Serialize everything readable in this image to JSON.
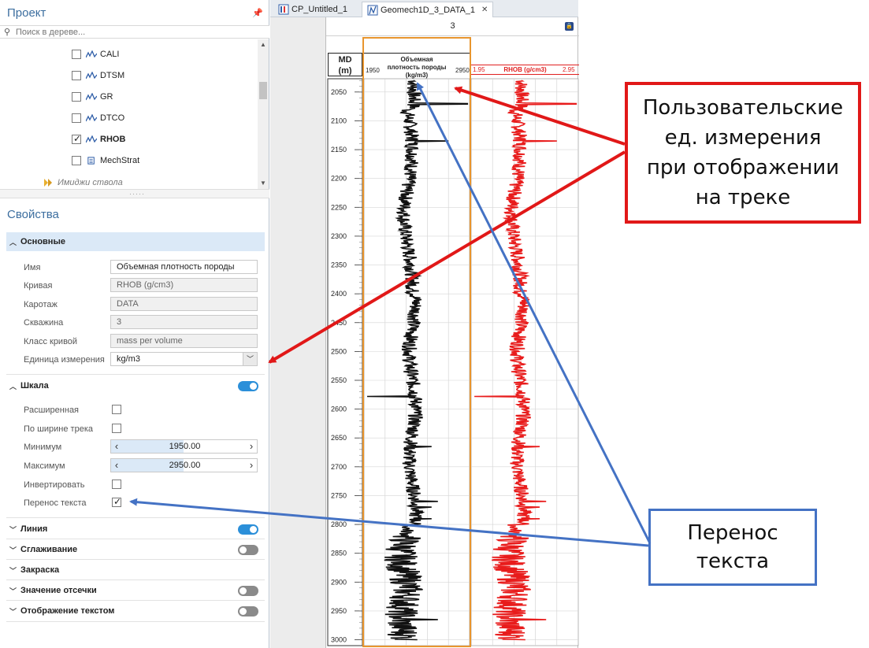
{
  "project_panel": {
    "title": "Проект",
    "search_placeholder": "Поиск в дереве...",
    "tree_items": [
      {
        "label": "CALI",
        "checked": false
      },
      {
        "label": "DTSM",
        "checked": false
      },
      {
        "label": "GR",
        "checked": false
      },
      {
        "label": "DTCO",
        "checked": false
      },
      {
        "label": "RHOB",
        "checked": true
      },
      {
        "label": "MechStrat",
        "checked": false
      }
    ],
    "folder_label": "Имиджи ствола"
  },
  "properties": {
    "title": "Свойства",
    "sections": {
      "main": "Основные",
      "scale": "Шкала",
      "line": "Линия",
      "smoothing": "Сглаживание",
      "fill": "Закраска",
      "cutoff": "Значение отсечки",
      "text_display": "Отображение текстом"
    },
    "fields": {
      "name_label": "Имя",
      "name_value": "Объемная плотность породы",
      "curve_label": "Кривая",
      "curve_value": "RHOB (g/cm3)",
      "log_label": "Каротаж",
      "log_value": "DATA",
      "well_label": "Скважина",
      "well_value": "3",
      "curve_class_label": "Класс кривой",
      "curve_class_value": "mass per volume",
      "unit_label": "Единица измерения",
      "unit_value": "kg/m3"
    },
    "scale": {
      "extended_label": "Расширенная",
      "track_width_label": "По ширине трека",
      "min_label": "Минимум",
      "min_value": "1950.00",
      "max_label": "Максимум",
      "max_value": "2950.00",
      "invert_label": "Инвертировать",
      "wrap_label": "Перенос текста"
    }
  },
  "tabs": [
    {
      "label": "CP_Untitled_1",
      "active": false
    },
    {
      "label": "Geomech1D_3_DATA_1",
      "active": true,
      "close": "✕"
    }
  ],
  "plot": {
    "track_title": "3",
    "md_label": "MD",
    "md_unit": "(m)",
    "track1_title": "Объемная плотность породы (kg/m3)",
    "track1_min": "1950",
    "track1_max": "2950",
    "track2_title": "RHOB (g/cm3)",
    "track2_min": "1.95",
    "track2_max": "2.95",
    "depth_ticks": [
      "2050",
      "2100",
      "2150",
      "2200",
      "2250",
      "2300",
      "2350",
      "2400",
      "2450",
      "2500",
      "2550",
      "2600",
      "2650",
      "2700",
      "2750",
      "2800",
      "2850",
      "2900",
      "2950",
      "3000"
    ],
    "track1_color": "#111111",
    "track2_color": "#e81c1c",
    "highlight_color": "#e8952e"
  },
  "callouts": {
    "red_text": [
      "Пользовательские",
      "ед. измерения",
      "при отображении",
      "на треке"
    ],
    "blue_text": [
      "Перенос",
      "текста"
    ],
    "red_color": "#e11818",
    "blue_color": "#4472c4"
  }
}
